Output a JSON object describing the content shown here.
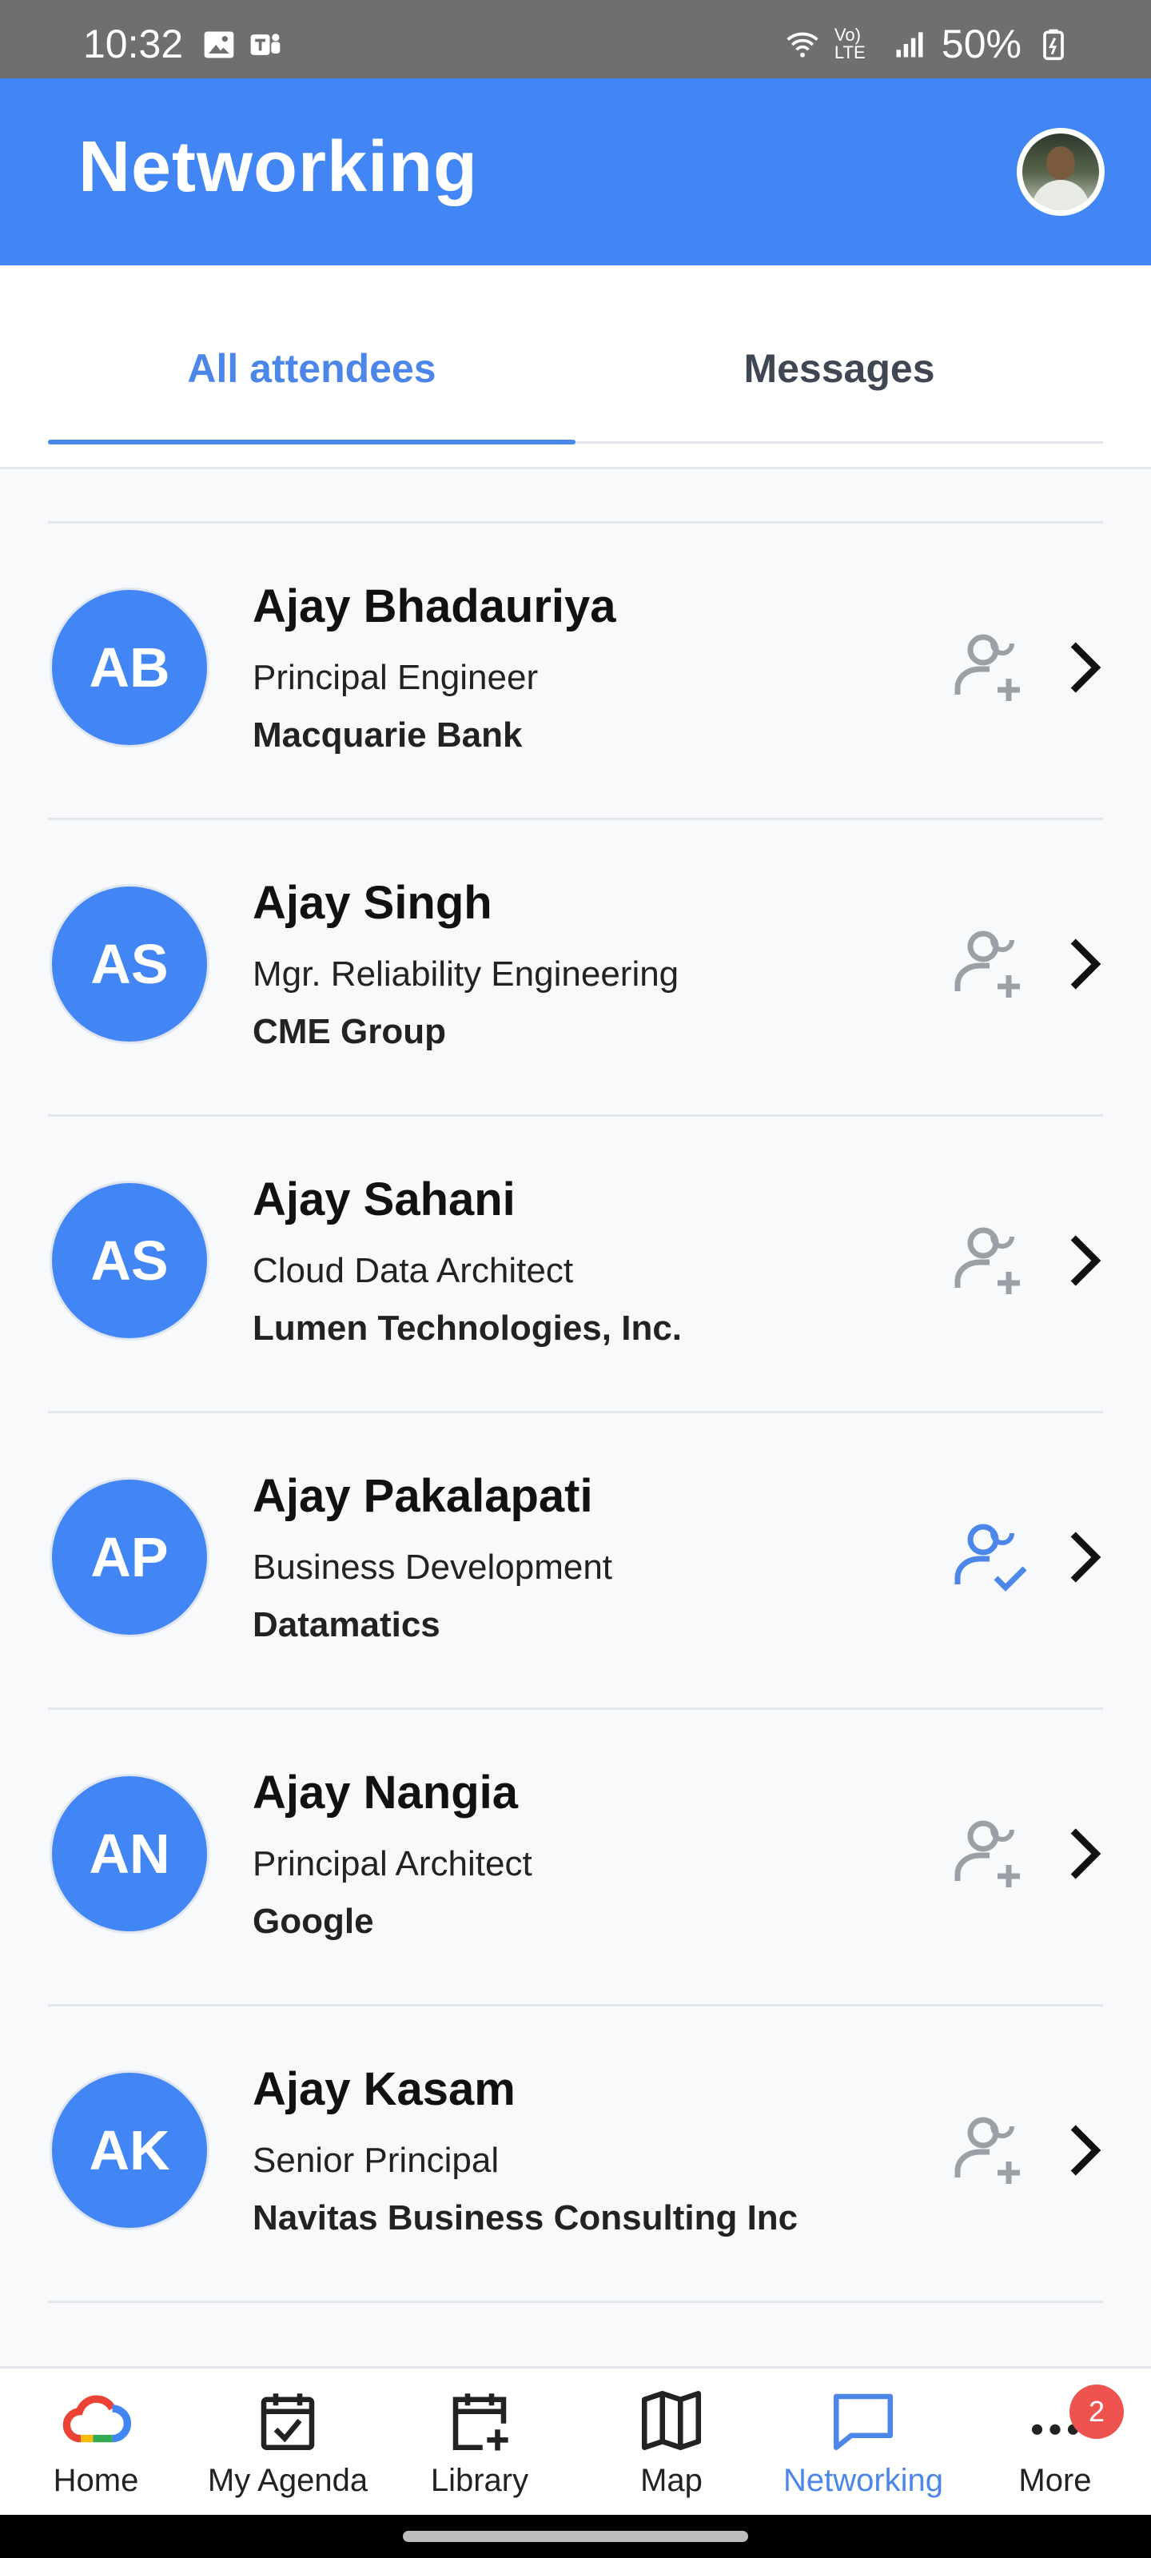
{
  "status_bar": {
    "time": "10:32",
    "battery": "50%",
    "network": "Vo) LTE"
  },
  "header": {
    "title": "Networking"
  },
  "tabs": [
    {
      "label": "All attendees",
      "active": true
    },
    {
      "label": "Messages",
      "active": false
    }
  ],
  "attendees": [
    {
      "initials": "AB",
      "name": "Ajay Bhadauriya",
      "title": "Principal Engineer",
      "company": "Macquarie Bank",
      "connected": false
    },
    {
      "initials": "AS",
      "name": "Ajay Singh",
      "title": "Mgr. Reliability Engineering",
      "company": "CME Group",
      "connected": false
    },
    {
      "initials": "AS",
      "name": "Ajay Sahani",
      "title": "Cloud Data Architect",
      "company": "Lumen Technologies, Inc.",
      "connected": false
    },
    {
      "initials": "AP",
      "name": "Ajay Pakalapati",
      "title": "Business Development",
      "company": "Datamatics",
      "connected": true
    },
    {
      "initials": "AN",
      "name": "Ajay Nangia",
      "title": "Principal Architect",
      "company": "Google",
      "connected": false
    },
    {
      "initials": "AK",
      "name": "Ajay Kasam",
      "title": "Senior Principal",
      "company": "Navitas Business Consulting Inc",
      "connected": false
    }
  ],
  "bottom_nav": [
    {
      "label": "Home",
      "icon": "google-cloud-icon",
      "active": false
    },
    {
      "label": "My Agenda",
      "icon": "calendar-check-icon",
      "active": false
    },
    {
      "label": "Library",
      "icon": "calendar-add-icon",
      "active": false
    },
    {
      "label": "Map",
      "icon": "map-icon",
      "active": false
    },
    {
      "label": "Networking",
      "icon": "chat-icon",
      "active": true
    },
    {
      "label": "More",
      "icon": "more-horizontal-icon",
      "active": false,
      "badge": "2"
    }
  ],
  "colors": {
    "primary": "#4285f4",
    "accent_text": "#4c86e8",
    "badge": "#ef5350"
  }
}
